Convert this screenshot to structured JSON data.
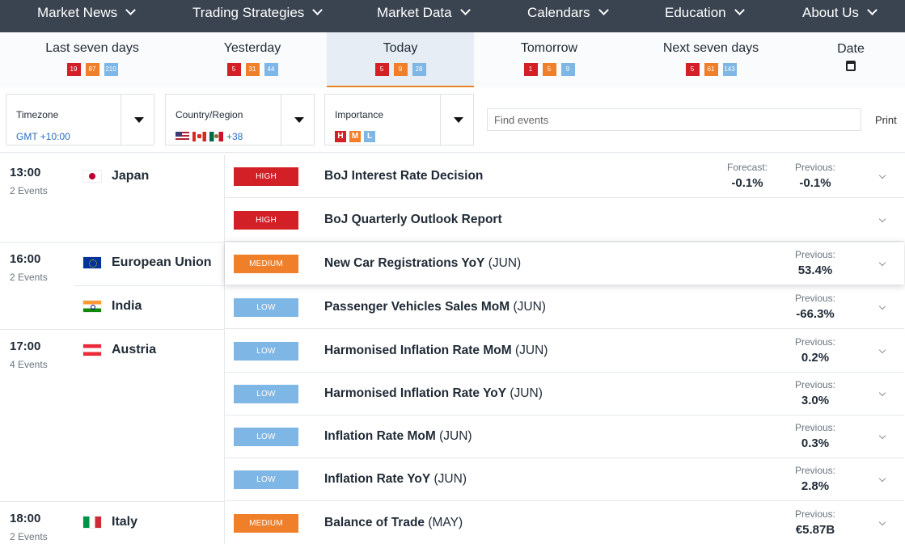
{
  "nav": [
    {
      "label": "Market News"
    },
    {
      "label": "Trading Strategies"
    },
    {
      "label": "Market Data"
    },
    {
      "label": "Calendars"
    },
    {
      "label": "Education"
    },
    {
      "label": "About Us"
    }
  ],
  "days": [
    {
      "label": "Last seven days",
      "high": "19",
      "medium": "87",
      "low": "210"
    },
    {
      "label": "Yesterday",
      "high": "5",
      "medium": "31",
      "low": "44"
    },
    {
      "label": "Today",
      "high": "5",
      "medium": "9",
      "low": "28",
      "active": true
    },
    {
      "label": "Tomorrow",
      "high": "1",
      "medium": "5",
      "low": "9"
    },
    {
      "label": "Next seven days",
      "high": "5",
      "medium": "61",
      "low": "143"
    }
  ],
  "date_tab": {
    "label": "Date",
    "icon": "calendar-icon"
  },
  "filters": {
    "timezone": {
      "title": "Timezone",
      "value": "GMT +10:00"
    },
    "country": {
      "title": "Country/Region",
      "more": "+38",
      "flags": [
        "us",
        "ca",
        "mx"
      ]
    },
    "importance": {
      "title": "Importance",
      "levels": [
        "H",
        "M",
        "L"
      ]
    },
    "search_placeholder": "Find events",
    "print_label": "Print"
  },
  "colors": {
    "high": "#d32027",
    "medium": "#f07f2a",
    "low": "#7eb6e6",
    "nav_bg": "#3a4450",
    "link": "#2a6ebb"
  },
  "groups": [
    {
      "time": "13:00",
      "events_label": "2 Events",
      "countries": [
        {
          "name": "Japan",
          "flag": "jp",
          "events": [
            {
              "importance": "HIGH",
              "name": "BoJ Interest Rate Decision",
              "period": "",
              "forecast_label": "Forecast:",
              "forecast": "-0.1%",
              "previous_label": "Previous:",
              "previous": "-0.1%"
            },
            {
              "importance": "HIGH",
              "name": "BoJ Quarterly Outlook Report",
              "period": "",
              "forecast_label": "",
              "forecast": "",
              "previous_label": "",
              "previous": ""
            }
          ]
        }
      ]
    },
    {
      "time": "16:00",
      "events_label": "2 Events",
      "countries": [
        {
          "name": "European Union",
          "flag": "eu",
          "events": [
            {
              "importance": "MEDIUM",
              "name": "New Car Registrations YoY",
              "period": "(JUN)",
              "forecast_label": "",
              "forecast": "",
              "previous_label": "Previous:",
              "previous": "53.4%",
              "elevated": true
            }
          ]
        },
        {
          "name": "India",
          "flag": "in",
          "events": [
            {
              "importance": "LOW",
              "name": "Passenger Vehicles Sales MoM",
              "period": "(JUN)",
              "forecast_label": "",
              "forecast": "",
              "previous_label": "Previous:",
              "previous": "-66.3%"
            }
          ]
        }
      ]
    },
    {
      "time": "17:00",
      "events_label": "4 Events",
      "countries": [
        {
          "name": "Austria",
          "flag": "at",
          "events": [
            {
              "importance": "LOW",
              "name": "Harmonised Inflation Rate MoM",
              "period": "(JUN)",
              "forecast_label": "",
              "forecast": "",
              "previous_label": "Previous:",
              "previous": "0.2%"
            },
            {
              "importance": "LOW",
              "name": "Harmonised Inflation Rate YoY",
              "period": "(JUN)",
              "forecast_label": "",
              "forecast": "",
              "previous_label": "Previous:",
              "previous": "3.0%"
            },
            {
              "importance": "LOW",
              "name": "Inflation Rate MoM",
              "period": "(JUN)",
              "forecast_label": "",
              "forecast": "",
              "previous_label": "Previous:",
              "previous": "0.3%"
            },
            {
              "importance": "LOW",
              "name": "Inflation Rate YoY",
              "period": "(JUN)",
              "forecast_label": "",
              "forecast": "",
              "previous_label": "Previous:",
              "previous": "2.8%"
            }
          ]
        }
      ]
    },
    {
      "time": "18:00",
      "events_label": "2 Events",
      "countries": [
        {
          "name": "Italy",
          "flag": "it",
          "events": [
            {
              "importance": "MEDIUM",
              "name": "Balance of Trade",
              "period": "(MAY)",
              "forecast_label": "",
              "forecast": "",
              "previous_label": "Previous:",
              "previous": "€5.87B"
            }
          ]
        }
      ]
    }
  ]
}
